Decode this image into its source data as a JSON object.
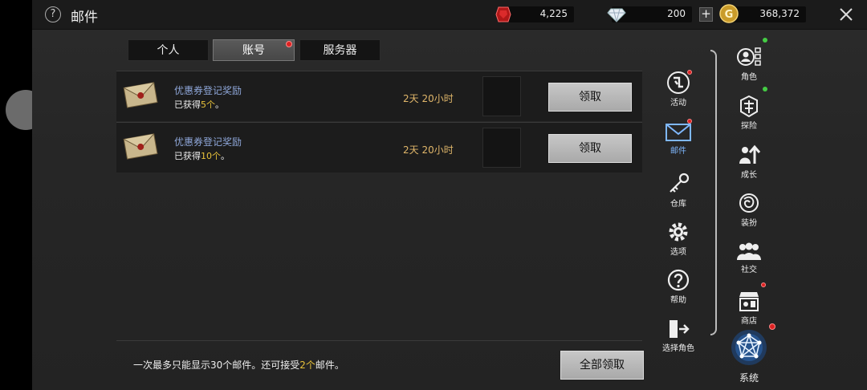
{
  "header": {
    "title": "邮件",
    "help_glyph": "?",
    "currencies": [
      {
        "name": "ruby-icon",
        "value": "4,225"
      },
      {
        "name": "diamond-icon",
        "value": "200"
      },
      {
        "name": "gold-icon",
        "value": "368,372",
        "glyph": "G"
      }
    ],
    "plus_glyph": "+"
  },
  "tabs": [
    {
      "label": "个人",
      "active": false
    },
    {
      "label": "账号",
      "active": true
    },
    {
      "label": "服务器",
      "active": false
    }
  ],
  "mails": [
    {
      "subject": "优惠券登记奖励",
      "desc_prefix": "已获得",
      "count": "5个",
      "desc_suffix": "。",
      "time": "2天 20小时",
      "claim_label": "领取"
    },
    {
      "subject": "优惠券登记奖励",
      "desc_prefix": "已获得",
      "count": "10个",
      "desc_suffix": "。",
      "time": "2天 20小时",
      "claim_label": "领取"
    }
  ],
  "footer": {
    "text_prefix": "一次最多只能显示30个邮件。还可接受",
    "count": "2个",
    "text_suffix": "邮件。",
    "claim_all_label": "全部领取"
  },
  "inner_menu": [
    {
      "label": "活动",
      "icon": "event-icon"
    },
    {
      "label": "邮件",
      "icon": "mail-icon",
      "active": true
    },
    {
      "label": "仓库",
      "icon": "key-icon"
    },
    {
      "label": "选项",
      "icon": "gear-icon"
    },
    {
      "label": "帮助",
      "icon": "help-icon"
    },
    {
      "label": "选择角色",
      "icon": "exit-icon"
    }
  ],
  "outer_menu": [
    {
      "label": "角色",
      "icon": "character-icon"
    },
    {
      "label": "探险",
      "icon": "adventure-icon"
    },
    {
      "label": "成长",
      "icon": "growth-icon"
    },
    {
      "label": "装扮",
      "icon": "costume-icon"
    },
    {
      "label": "社交",
      "icon": "social-icon"
    },
    {
      "label": "商店",
      "icon": "shop-icon"
    }
  ],
  "system": {
    "label": "系统"
  },
  "colors": {
    "accent_gold": "#e8c23a",
    "link_blue": "#8ea6d8",
    "badge_red": "#dd2222",
    "badge_green": "#44cc44"
  }
}
